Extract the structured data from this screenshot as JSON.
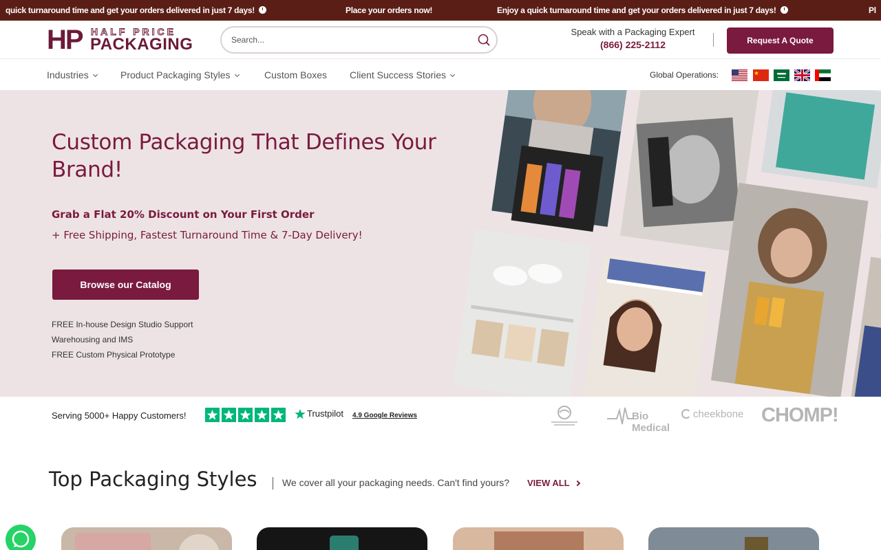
{
  "announcement": {
    "segments": [
      "quick turnaround time and get your orders delivered in just 7 days!",
      "Place your orders now!",
      "Enjoy a quick turnaround time and get your orders delivered in just 7 days!",
      "Pl"
    ]
  },
  "header": {
    "logo": {
      "hp": "HP",
      "line1": "HALF PRICE",
      "line2": "PACKAGING"
    },
    "search": {
      "placeholder": "Search...",
      "value": ""
    },
    "expert": {
      "label": "Speak with a Packaging Expert",
      "phone": "(866) 225-2112"
    },
    "quote_button": "Request A Quote"
  },
  "nav": {
    "items": [
      {
        "label": "Industries",
        "has_dropdown": true
      },
      {
        "label": "Product Packaging Styles",
        "has_dropdown": true
      },
      {
        "label": "Custom Boxes",
        "has_dropdown": false
      },
      {
        "label": "Client Success Stories",
        "has_dropdown": true
      }
    ],
    "global_label": "Global Operations:",
    "flags": [
      "us-flag-icon",
      "china-flag-icon",
      "saudi-arabia-flag-icon",
      "uk-flag-icon",
      "uae-flag-icon"
    ]
  },
  "hero": {
    "title": "Custom Packaging That Defines Your Brand!",
    "subtitle": "Grab a Flat 20% Discount on Your First Order",
    "subtitle2": "+ Free Shipping, Fastest Turnaround Time & 7-Day Delivery!",
    "cta": "Browse our Catalog",
    "features": [
      "FREE In-house Design Studio Support",
      "Warehousing and IMS",
      "FREE Custom Physical Prototype"
    ]
  },
  "trust": {
    "serving": "Serving 5000+ Happy Customers!",
    "trustpilot": "Trustpilot",
    "google": "4.9 Google Reviews",
    "partners": [
      "Bio Medical",
      "cheekbone",
      "CHOMP!"
    ]
  },
  "top_styles": {
    "title": "Top Packaging Styles",
    "subtitle": "We cover all your packaging needs. Can't find yours?",
    "view_all": "VIEW ALL"
  },
  "colors": {
    "brand": "#7a1a3e",
    "announcement_bg": "#5a1e16",
    "hero_bg": "#ede3e5",
    "trustpilot_green": "#00b67a",
    "whatsapp_green": "#25d366"
  }
}
